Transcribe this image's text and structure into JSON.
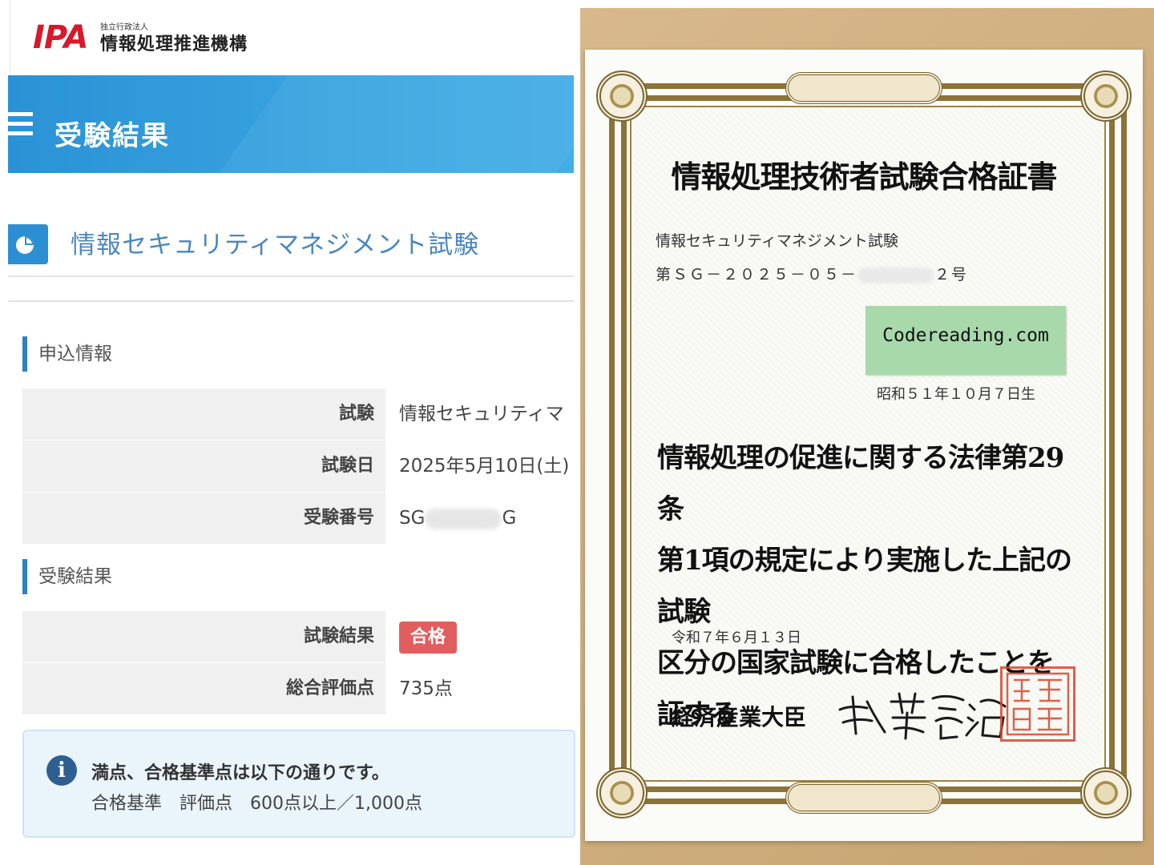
{
  "ipa": {
    "logo": "IPA",
    "org_small": "独立行政法人",
    "org": "情報処理推進機構"
  },
  "page": {
    "title": "受験結果"
  },
  "exam": {
    "name": "情報セキュリティマネジメント試験"
  },
  "application": {
    "heading": "申込情報",
    "rows": [
      {
        "key": "試験",
        "value": "情報セキュリティマ"
      },
      {
        "key": "試験日",
        "value": "2025年5月10日(土)"
      },
      {
        "key": "受験番号",
        "value_prefix": "SG",
        "value_suffix": "G"
      }
    ]
  },
  "result": {
    "heading": "受験結果",
    "rows": [
      {
        "key": "試験結果",
        "value": "合格"
      },
      {
        "key": "総合評価点",
        "value": "735点"
      }
    ]
  },
  "info": {
    "heading": "満点、合格基準点は以下の通りです。",
    "detail": "合格基準　評価点　600点以上／1,000点"
  },
  "certificate": {
    "title": "情報処理技術者試験合格証書",
    "exam": "情報セキュリティマネジメント試験",
    "number_prefix": "第ＳＧ－２０２５－０５－",
    "number_suffix": "２号",
    "sticker": "Codereading.com",
    "birth": "昭和５１年１０月７日生",
    "body": [
      "情報処理の促進に関する法律第29条",
      "第1項の規定により実施した上記の試験",
      "区分の国家試験に合格したことを証する"
    ],
    "date": "令和７年６月１３日",
    "minister": "経済産業大臣",
    "signature": "武藤容治",
    "seal": "経済産業大臣印"
  },
  "colors": {
    "ipa_red": "#d7192b",
    "header_blue": "#2a92d6",
    "pass_badge": "#e25e5e",
    "seal_red": "#d6472f"
  }
}
